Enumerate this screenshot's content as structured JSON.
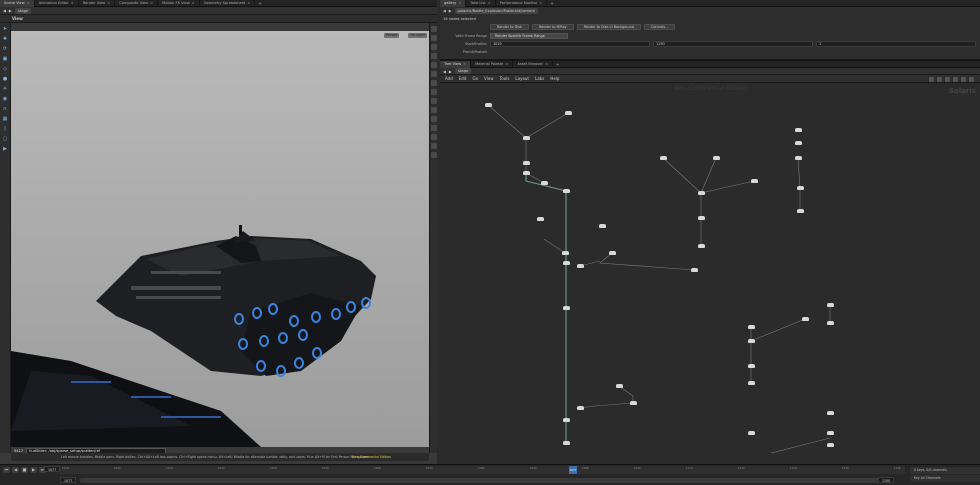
{
  "left_tabs": [
    "Scene View",
    "Animation Editor",
    "Render View",
    "Composite View",
    "Motion FX View",
    "Geometry Spreadsheet"
  ],
  "right_tabs_top": [
    "gallery",
    "Take List",
    "Performance Monitor"
  ],
  "right_tabs_network": [
    "Tree View",
    "Material Palette",
    "Asset Browser"
  ],
  "viewport": {
    "path_context": "stage",
    "view_label": "View",
    "chip_persp": "Persp▾",
    "chip_cam": "No cam▾",
    "cmd_label": "hudSlider",
    "cmd_value": "/obj/sparse_setup/scatter/ref",
    "status_text": "Left mouse tumbles. Middle pans. Right dollies. Ctrl+Alt+Left box-zooms. Ctrl+Right opens menu. Alt+Left/ Middle for alternate tumble, dolly, and zoom.   M or Alt+M for First Person Navigation.",
    "noncommercial": "Non-Commercial Edition",
    "frame_label": "5417"
  },
  "render_pane": {
    "path": "galactic/Battle_Explosion/Fasteraid/camera",
    "nodes_selected": "16 nodes selected",
    "buttons": [
      "Render to Disk",
      "Render to MPlay",
      "Render to Disk in Background",
      "Controls..."
    ],
    "valid_frame_range_label": "Valid Frame Range",
    "valid_frame_range_value": "Render Specific Frame Range",
    "start_end_label": "Start/End/Inc",
    "start": "1010",
    "end": "1150",
    "inc": "1",
    "preroll_label": "Preroll/Postroll"
  },
  "network": {
    "path_context": "stage",
    "menu": [
      "Add",
      "Edit",
      "Go",
      "View",
      "Tools",
      "Layout",
      "Labs",
      "Help"
    ],
    "watermark": "Non-Commercial Edition",
    "context_label": "Solaris"
  },
  "timeline": {
    "current_frame": "1077",
    "start_frame": "1077",
    "end_frame": "1150",
    "range_start": "1077",
    "range_end": "1150",
    "keys_label": "0 keys, 0/0 channels",
    "key_all_label": "Key All Channels",
    "ticks": [
      "1018",
      "1026",
      "1034",
      "1042",
      "1050",
      "1058",
      "1066",
      "1074",
      "1082",
      "1090",
      "1098",
      "1106",
      "1114",
      "1122",
      "1130",
      "1138",
      "1146"
    ]
  },
  "colors": {
    "accent": "#3c6fb0",
    "wire": "#6f9a86",
    "node": "#d8d8d8",
    "noncommercial": "#e6d23c"
  }
}
